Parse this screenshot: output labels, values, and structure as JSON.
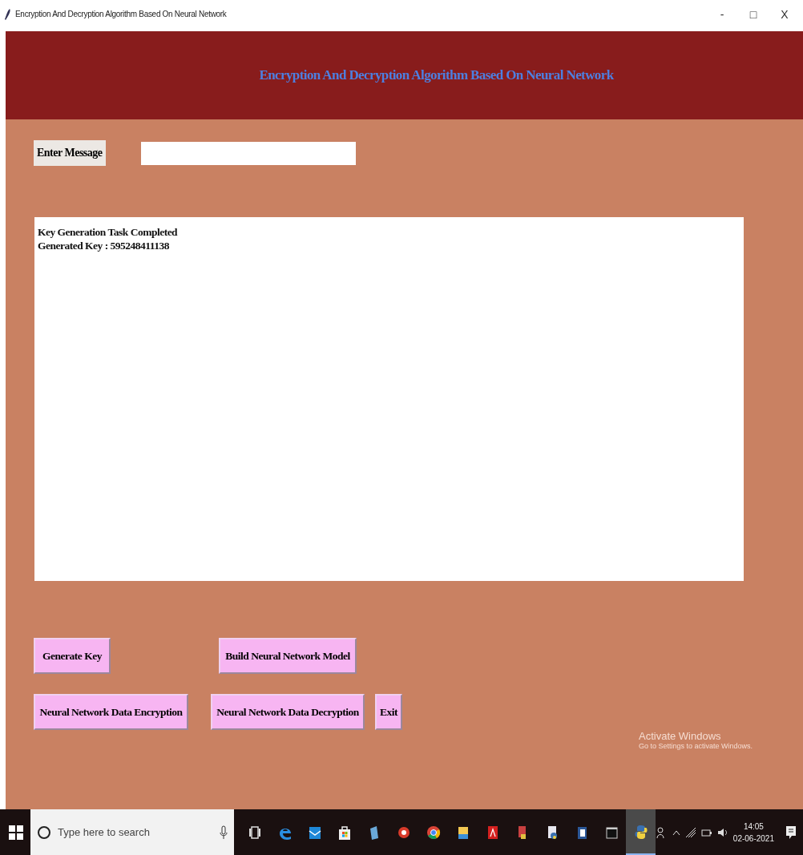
{
  "window": {
    "title": "Encryption And Decryption Algorithm Based On Neural Network",
    "controls": [
      "-",
      "□",
      "X"
    ]
  },
  "header": {
    "title": "Encryption And Decryption Algorithm Based On Neural Network"
  },
  "message": {
    "label": "Enter Message"
  },
  "output": {
    "lines": [
      "Key Generation Task Completed",
      "Generated Key : 595248411138"
    ]
  },
  "button_rows": [
    {
      "buttons": [
        "Generate Key",
        "Build Neural Network Model"
      ]
    },
    {
      "buttons": [
        "Neural Network Data Encryption",
        "Neural Network Data Decryption",
        "Exit"
      ]
    }
  ],
  "activation_notice": {
    "title": "Activate Windows",
    "subtitle": "Go to Settings to activate Windows."
  },
  "taskbar": {
    "search": {
      "placeholder": "Type here to search"
    },
    "apps": [
      {
        "kind": "taskview",
        "selected": false
      },
      {
        "kind": "edge",
        "selected": false
      },
      {
        "kind": "mail",
        "selected": false
      },
      {
        "kind": "store",
        "selected": false
      },
      {
        "kind": "book",
        "selected": false
      },
      {
        "kind": "red",
        "selected": false
      },
      {
        "kind": "chrome",
        "selected": false
      },
      {
        "kind": "folder",
        "selected": false
      },
      {
        "kind": "pdf",
        "selected": false
      },
      {
        "kind": "doc",
        "selected": false
      },
      {
        "kind": "python-file",
        "selected": false
      },
      {
        "kind": "word",
        "selected": false
      },
      {
        "kind": "terminal",
        "selected": false
      },
      {
        "kind": "python",
        "selected": true
      }
    ],
    "time": "14:05",
    "date": "02-06-2021"
  }
}
